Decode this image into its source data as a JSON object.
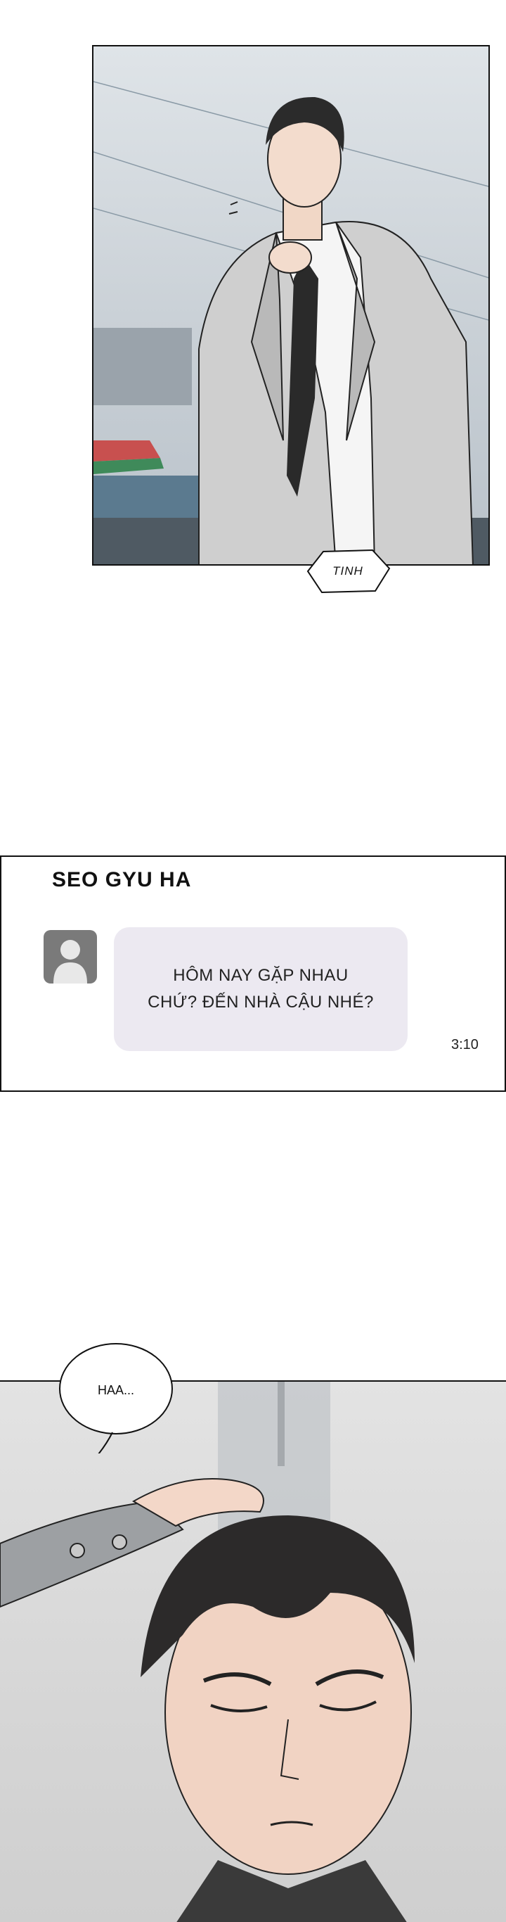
{
  "panel1": {
    "sfx": "TINH"
  },
  "chat": {
    "contact_name": "SEO GYU HA",
    "message_lines": [
      "HÔM NAY GẶP NHAU",
      "CHỨ? ĐẾN NHÀ CẬU NHÉ?"
    ],
    "time": "3:10",
    "colors": {
      "bubble": "#ece9f1",
      "avatar": "#7a7a7a"
    }
  },
  "panel3": {
    "speech": "HAA..."
  }
}
